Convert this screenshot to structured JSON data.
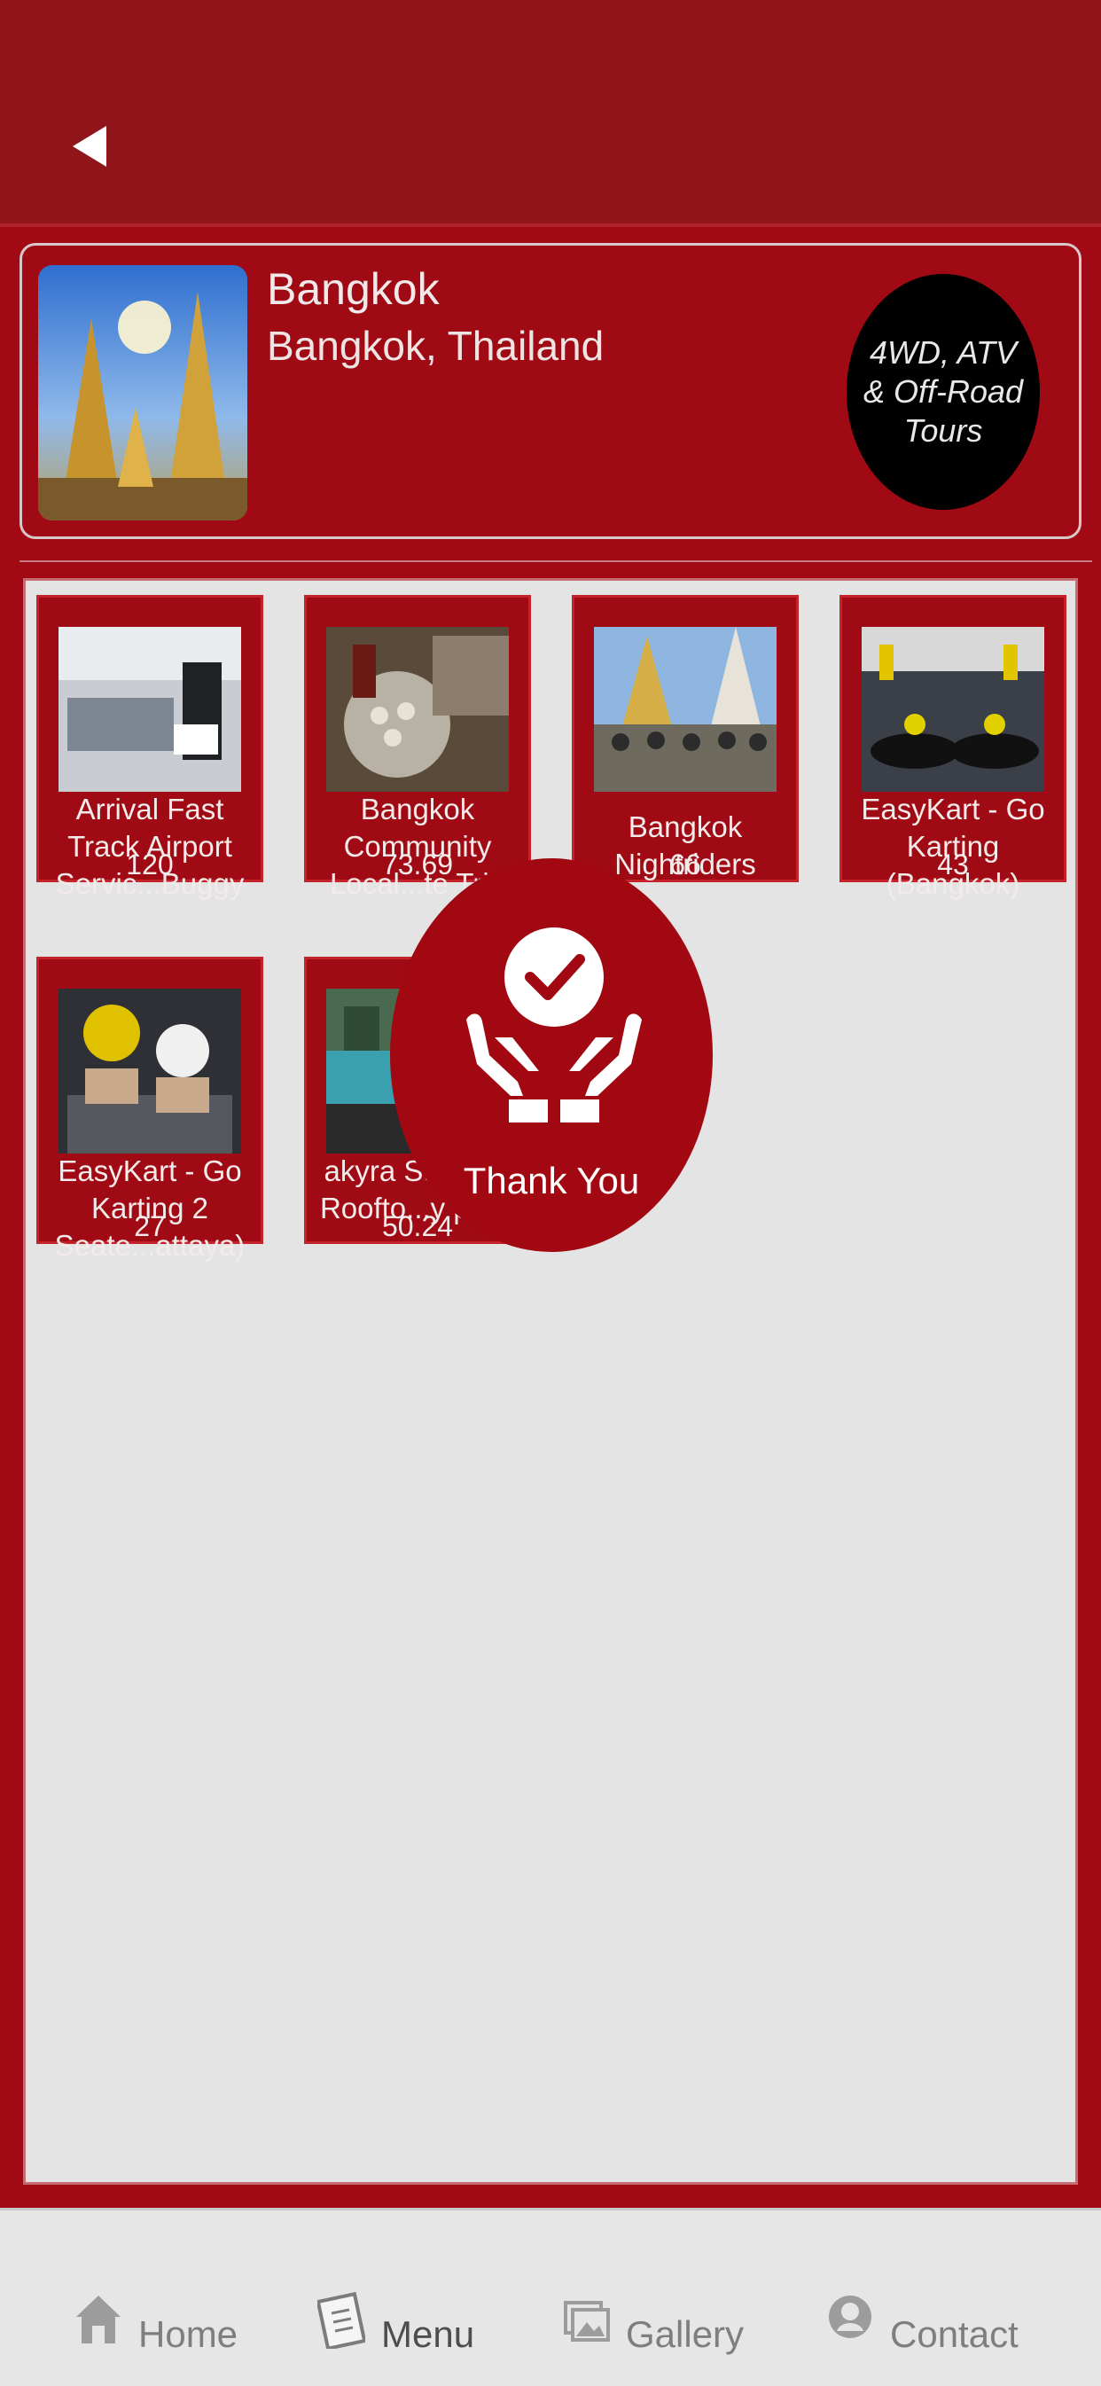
{
  "header": {
    "title": "Bangkok",
    "subtitle": "Bangkok, Thailand",
    "category_badge": "4WD, ATV & Off-Road Tours"
  },
  "tours": [
    {
      "name": "Arrival Fast Track Airport Servic...Buggy",
      "price": "120"
    },
    {
      "name": "Bangkok Community Local...te Trip",
      "price": "73.69"
    },
    {
      "name": "Bangkok Nightriders",
      "price": "66"
    },
    {
      "name": "EasyKart - Go Karting (Bangkok)",
      "price": "43"
    },
    {
      "name": "EasyKart - Go Karting 2 Seate...attaya)",
      "price": "27"
    },
    {
      "name": "akyra Sukhum Roofto...y pass",
      "price": "50.24"
    }
  ],
  "overlay": {
    "label": "Thank You"
  },
  "tabbar": {
    "home": "Home",
    "menu": "Menu",
    "gallery": "Gallery",
    "contact": "Contact"
  },
  "colors": {
    "primary_red": "#a00a14",
    "header_red": "#8f151b",
    "content_bg": "#e4e4e4",
    "tab_text": "#7e7e7e"
  }
}
